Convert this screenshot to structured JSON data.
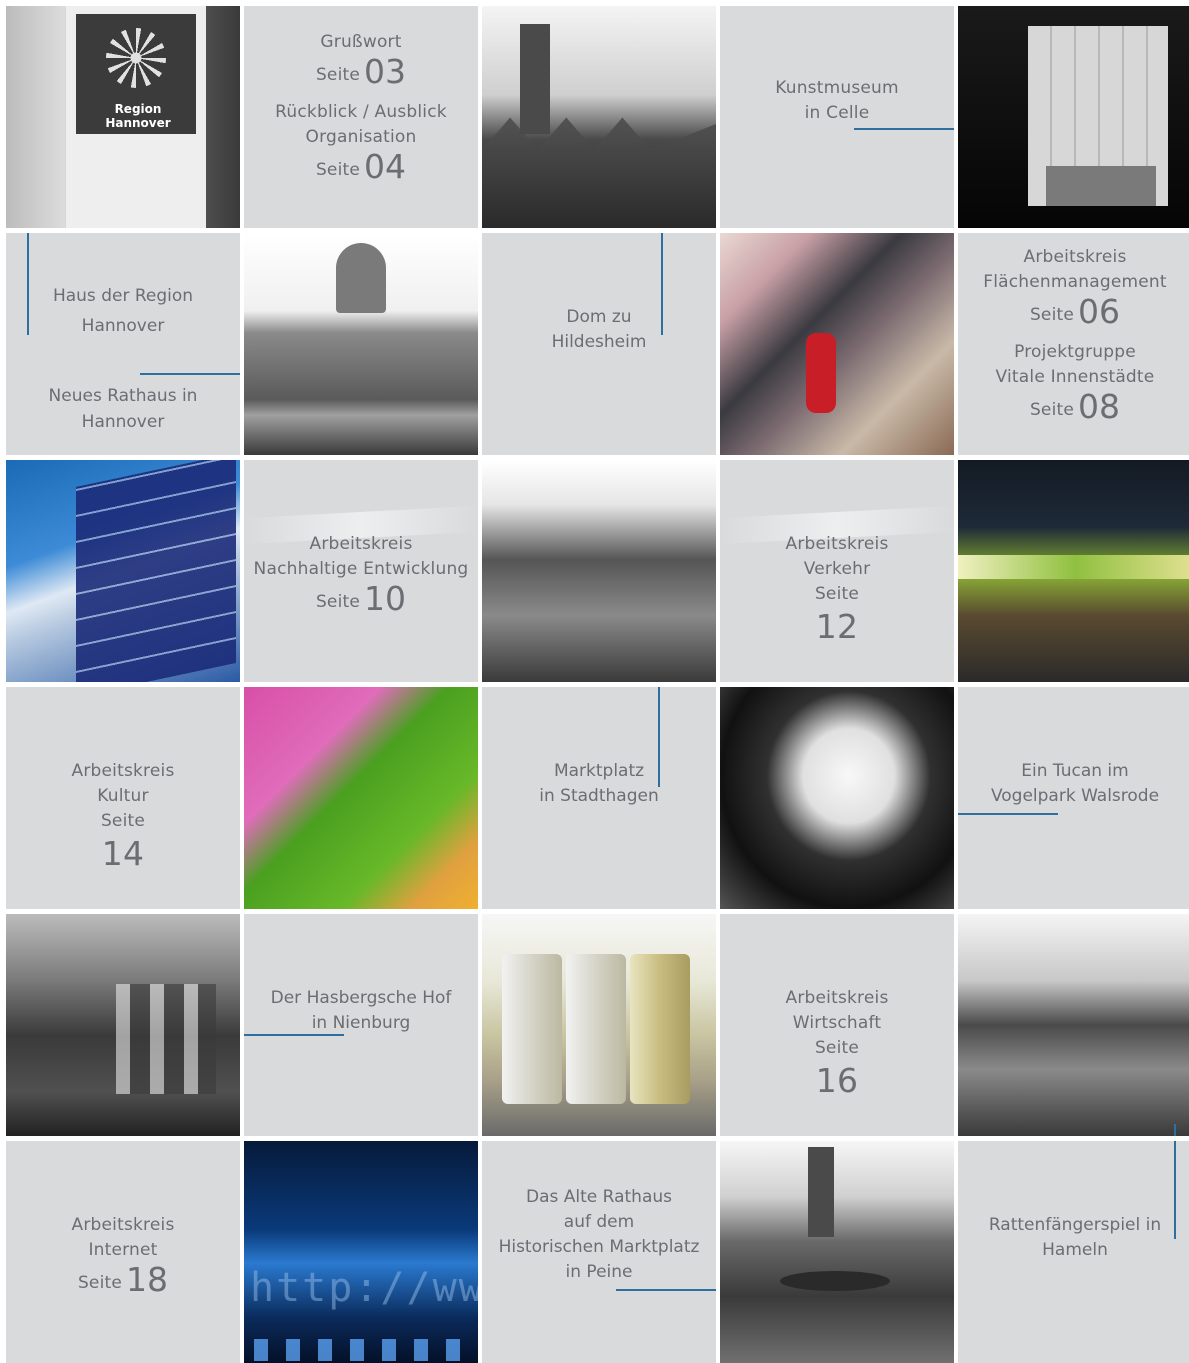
{
  "tiles": {
    "grusswort": {
      "title": "Grußwort",
      "seite": "Seite",
      "page": "03"
    },
    "rueckblick": {
      "title1": "Rückblick / Ausblick",
      "title2": "Organisation",
      "seite": "Seite",
      "page": "04"
    },
    "celle": {
      "line1": "Kunstmuseum",
      "line2": "in Celle"
    },
    "haus": {
      "line1": "Haus der Region",
      "line2": "Hannover"
    },
    "rathaus": {
      "line1": "Neues Rathaus in",
      "line2": "Hannover"
    },
    "dom": {
      "line1": "Dom zu",
      "line2": "Hildesheim"
    },
    "flaechen": {
      "line1": "Arbeitskreis",
      "line2": "Flächenmanagement",
      "seite": "Seite",
      "page": "06"
    },
    "vitale": {
      "line1": "Projektgruppe",
      "line2": "Vitale Innenstädte",
      "seite": "Seite",
      "page": "08"
    },
    "nachhaltig": {
      "line1": "Arbeitskreis",
      "line2": "Nachhaltige Entwicklung",
      "seite": "Seite",
      "page": "10"
    },
    "verkehr": {
      "line1": "Arbeitskreis",
      "line2": "Verkehr",
      "seite": "Seite",
      "page": "12"
    },
    "kultur": {
      "line1": "Arbeitskreis",
      "line2": "Kultur",
      "seite": "Seite",
      "page": "14"
    },
    "stadthagen": {
      "line1": "Marktplatz",
      "line2": "in Stadthagen"
    },
    "tucan": {
      "line1": "Ein Tucan im",
      "line2": "Vogelpark Walsrode"
    },
    "hasberg": {
      "line1": "Der Hasbergsche Hof",
      "line2": "in Nienburg"
    },
    "wirtschaft": {
      "line1": "Arbeitskreis",
      "line2": "Wirtschaft",
      "seite": "Seite",
      "page": "16"
    },
    "internet": {
      "line1": "Arbeitskreis",
      "line2": "Internet",
      "seite": "Seite",
      "page": "18"
    },
    "peine": {
      "line1": "Das Alte Rathaus",
      "line2": "auf dem",
      "line3": "Historischen Marktplatz",
      "line4": "in Peine"
    },
    "hameln": {
      "line1": "Rattenfängerspiel in",
      "line2": "Hameln"
    }
  },
  "photos": {
    "sign_logo_text": "Region Hannover",
    "http_text": "http://www"
  },
  "colors": {
    "tile_gray": "#d9dadc",
    "text_gray": "#6a6e73",
    "leader_blue": "#2f6f9f"
  }
}
